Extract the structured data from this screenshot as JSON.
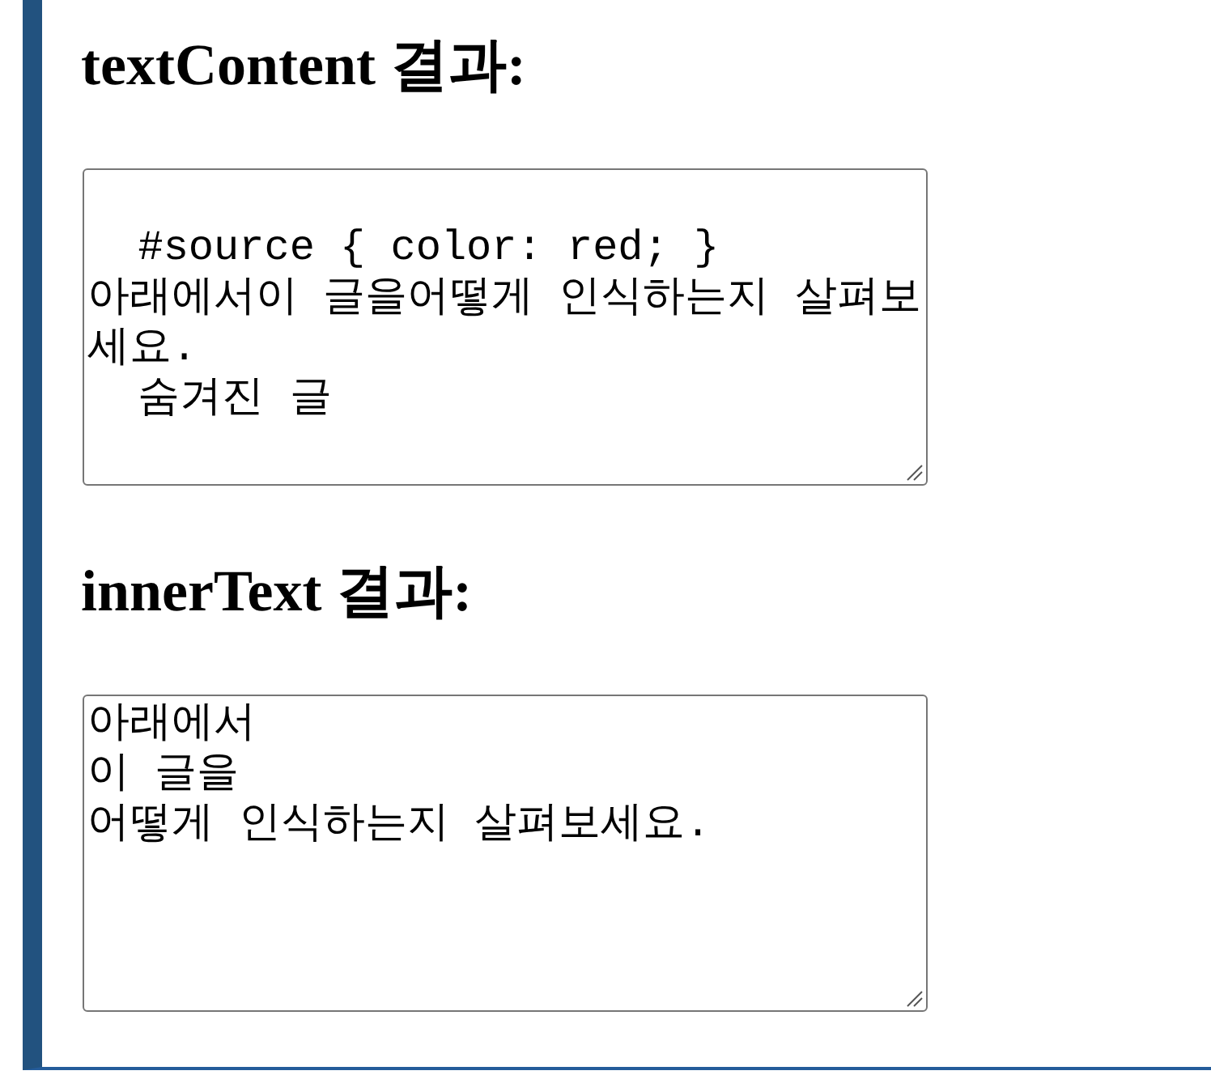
{
  "sections": [
    {
      "heading": "textContent 결과:",
      "output": {
        "value": "\n  #source { color: red; }\n아래에서이 글을어떻게 인식하는지 살펴보세요.\n  숨겨진 글"
      }
    },
    {
      "heading": "innerText 결과:",
      "output": {
        "value": "아래에서\n이 글을\n어떻게 인식하는지 살펴보세요."
      }
    }
  ]
}
